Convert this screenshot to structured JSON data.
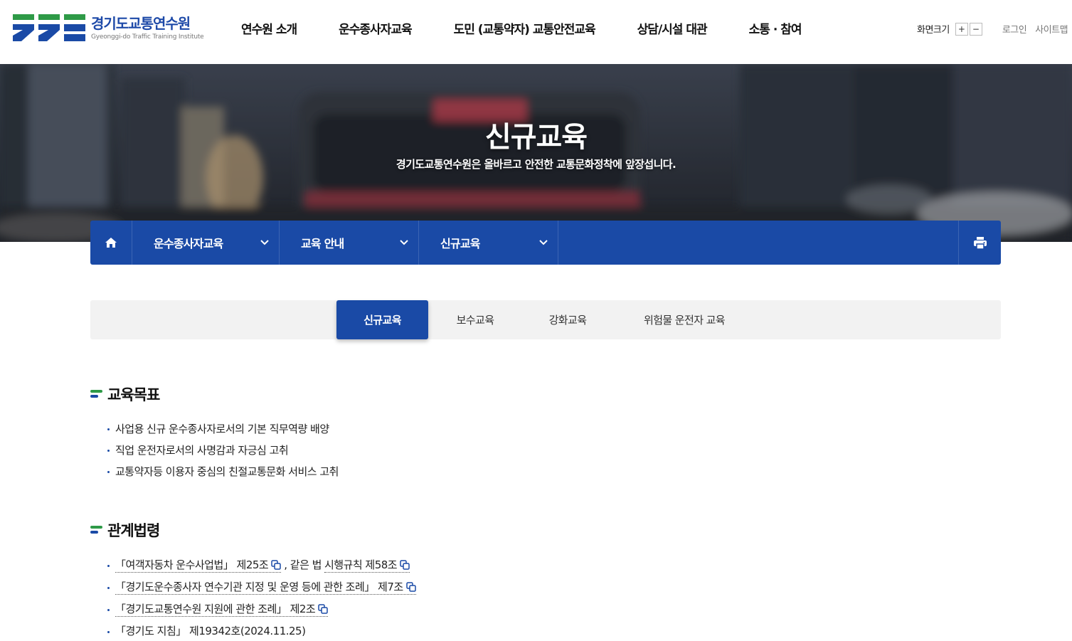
{
  "header": {
    "logo_kr": "경기도교통연수원",
    "logo_en": "Gyeonggi-do Traffic Training Institute",
    "nav": [
      "연수원 소개",
      "운수종사자교육",
      "도민 (교통약자) 교통안전교육",
      "상담/시설 대관",
      "소통 · 참여"
    ],
    "util": {
      "zoom_label": "화면크기",
      "zoom_in": "+",
      "zoom_out": "−",
      "login": "로그인",
      "sitemap": "사이트맵"
    }
  },
  "hero": {
    "title": "신규교육",
    "subtitle": "경기도교통연수원은 올바르고 안전한 교통문화정착에 앞장섭니다."
  },
  "location": {
    "crumbs": [
      "운수종사자교육",
      "교육 안내",
      "신규교육"
    ]
  },
  "tabs": [
    {
      "label": "신규교육",
      "active": true
    },
    {
      "label": "보수교육",
      "active": false
    },
    {
      "label": "강화교육",
      "active": false
    },
    {
      "label": "위험물 운전자 교육",
      "active": false
    }
  ],
  "goals": {
    "title": "교육목표",
    "items": [
      "사업용 신규 운수종사자로서의 기본 직무역량 배양",
      "직업 운전자로서의 사명감과 자긍심 고취",
      "교통약자등 이용자 중심의 친절교통문화 서비스 고취"
    ]
  },
  "laws": {
    "title": "관계법령",
    "items": [
      {
        "link": "「여객자동차 운수사업법」 제25조",
        "sep": ", 같은 법",
        "link2": "시행규칙 제58조"
      },
      {
        "link": "「경기도운수종사자 연수기관 지정 및 운영 등에 관한 조례」 제7조"
      },
      {
        "link": "「경기도교통연수원 지원에 관한 조례」 제2조"
      },
      {
        "text": "「경기도 지침」 제19342호(2024.11.25)"
      }
    ]
  },
  "colors": {
    "brand_blue": "#1a4aa6",
    "brand_green": "#2e9a47"
  }
}
